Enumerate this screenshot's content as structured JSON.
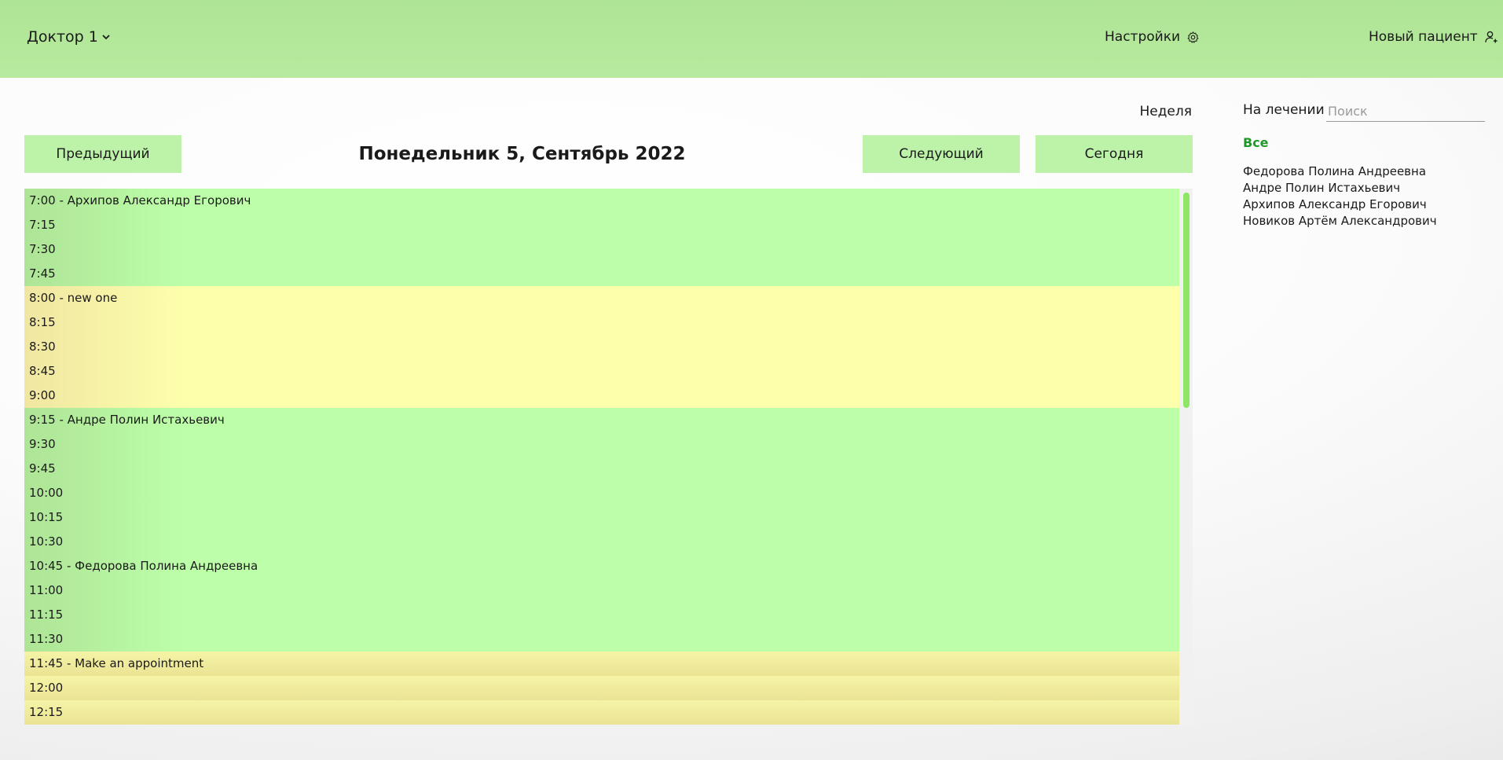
{
  "header": {
    "doctor_label": "Доктор 1",
    "settings_label": "Настройки",
    "new_patient_label": "Новый пациент"
  },
  "nav": {
    "week_label": "Неделя",
    "prev_label": "Предыдущий",
    "date_title": "Понедельник 5, Сентябрь 2022",
    "next_label": "Следующий",
    "today_label": "Сегодня"
  },
  "schedule": {
    "slots": [
      "7:00 - Архипов Александр Егорович",
      "7:15",
      "7:30",
      "7:45",
      "8:00 - new one",
      "8:15",
      "8:30",
      "8:45",
      "9:00",
      "9:15 - Андре Полин Истахьевич",
      "9:30",
      "9:45",
      "10:00",
      "10:15",
      "10:30",
      "10:45 - Федорова Полина Андреевна",
      "11:00",
      "11:15",
      "11:30",
      "11:45 - Make an appointment",
      "12:00",
      "12:15"
    ],
    "colors": {
      "booked": "#bdffa9",
      "other": "#fdffab",
      "free": "#f2eea0",
      "scrollbar": "#8ee665"
    }
  },
  "sidebar": {
    "tab_label": "На лечении",
    "search_placeholder": "Поиск",
    "filter_all": "Все",
    "patients": [
      "Федорова Полина Андреевна",
      "Андре Полин Истахьевич",
      "Архипов Александр Егорович",
      "Новиков Артём Александрович"
    ]
  },
  "icons": {
    "doctor_dropdown": "chevron-down-icon",
    "settings": "gear-icon",
    "new_patient": "user-plus-icon"
  }
}
